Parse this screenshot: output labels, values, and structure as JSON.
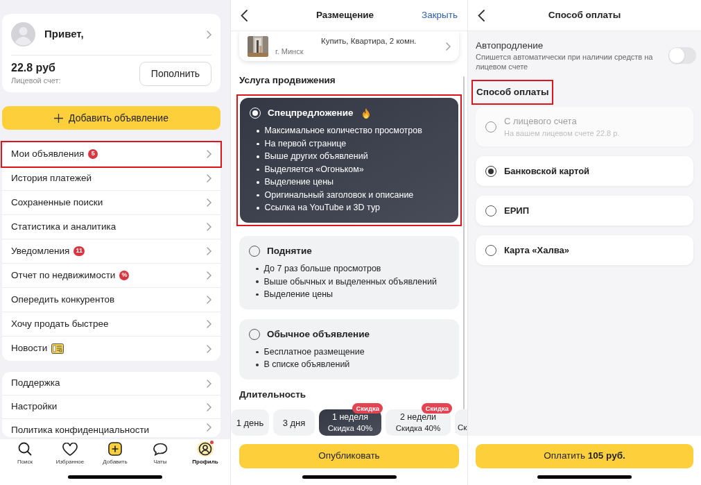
{
  "profile_screen": {
    "greeting": "Привет,",
    "balance": "22.8 руб",
    "account_label": "Лицевой счет:",
    "top_up_button": "Пополнить",
    "add_button": "Добавить объявление",
    "menu_groups": [
      [
        {
          "label": "Мои объявления",
          "kind": "badge",
          "badge": "5",
          "highlighted": true
        },
        {
          "label": "История платежей",
          "kind": "plain",
          "highlighted": false
        },
        {
          "label": "Сохраненные поиски",
          "kind": "plain",
          "highlighted": false
        },
        {
          "label": "Статистика и аналитика",
          "kind": "plain",
          "highlighted": false
        },
        {
          "label": "Уведомления",
          "kind": "badge",
          "badge": "11",
          "highlighted": false
        },
        {
          "label": "Отчет по недвижимости",
          "kind": "badge",
          "badge": "%",
          "highlighted": false
        },
        {
          "label": "Опередить конкурентов",
          "kind": "plain",
          "highlighted": false
        },
        {
          "label": "Хочу продать быстрее",
          "kind": "plain",
          "highlighted": false
        },
        {
          "label": "Новости",
          "kind": "icon",
          "highlighted": false
        }
      ],
      [
        {
          "label": "Поддержка",
          "kind": "plain",
          "highlighted": false
        },
        {
          "label": "Настройки",
          "kind": "plain",
          "highlighted": false
        },
        {
          "label": "Политика конфиденциальности",
          "kind": "plain",
          "highlighted": false
        }
      ]
    ],
    "tab_bar": [
      {
        "label": "Поиск",
        "selected": false,
        "notification_dot": false
      },
      {
        "label": "Избранное",
        "selected": false,
        "notification_dot": false
      },
      {
        "label": "Добавить",
        "selected": false,
        "notification_dot": false
      },
      {
        "label": "Чаты",
        "selected": false,
        "notification_dot": false
      },
      {
        "label": "Профиль",
        "selected": true,
        "notification_dot": true
      }
    ]
  },
  "placement_screen": {
    "title": "Размещение",
    "close_link": "Закрыть",
    "listing": {
      "title": "Купить, Квартира, 2 комн.",
      "city": "г. Минск"
    },
    "promotion_heading": "Услуга продвижения",
    "promotion_options": [
      {
        "title": "Спецпредложение",
        "selected": true,
        "highlighted": true,
        "hot": true,
        "features": [
          "Максимальное количество просмотров",
          "На первой странице",
          "Выше других объявлений",
          "Выделяется «Огоньком»",
          "Выделение цены",
          "Оригинальный заголовок и описание",
          "Ссылка на YouTube и 3D тур"
        ]
      },
      {
        "title": "Поднятие",
        "selected": false,
        "highlighted": false,
        "hot": false,
        "features": [
          "До 7 раз больше просмотров",
          "Выше обычных и выделенных объявлений",
          "Выделение цены"
        ]
      },
      {
        "title": "Обычное объявление",
        "selected": false,
        "highlighted": false,
        "hot": false,
        "features": [
          "Бесплатное размещение",
          "В списке объявлений"
        ]
      }
    ],
    "duration_heading": "Длительность",
    "durations": [
      {
        "label": "1 день",
        "selected": false
      },
      {
        "label": "3 дня",
        "selected": false
      },
      {
        "label": "1 неделя",
        "sublabel": "Скидка 40%",
        "tag": "Скидка",
        "selected": true
      },
      {
        "label": "2 недели",
        "sublabel": "Скидка 40%",
        "tag": "Скидка",
        "selected": false
      },
      {
        "sublabel": "Ск",
        "selected": false
      }
    ],
    "publish_button": "Опубликовать"
  },
  "payment_screen": {
    "title": "Способ оплаты",
    "autorenewal": {
      "title": "Автопродление",
      "description": "Спишется автоматически при наличии средств на лицевом счете",
      "on": false
    },
    "method_heading": {
      "text": "Способ оплаты",
      "highlighted": true
    },
    "methods": [
      {
        "label": "С лицевого счета",
        "sublabel": "На вашем лицевом счете 22.8 р.",
        "selected": false,
        "disabled": true
      },
      {
        "label": "Банковской картой",
        "selected": true,
        "disabled": false
      },
      {
        "label": "ЕРИП",
        "selected": false,
        "disabled": false
      },
      {
        "label": "Карта «Халва»",
        "selected": false,
        "disabled": false
      }
    ],
    "pay_button": "Оплатить **105 руб.**"
  }
}
